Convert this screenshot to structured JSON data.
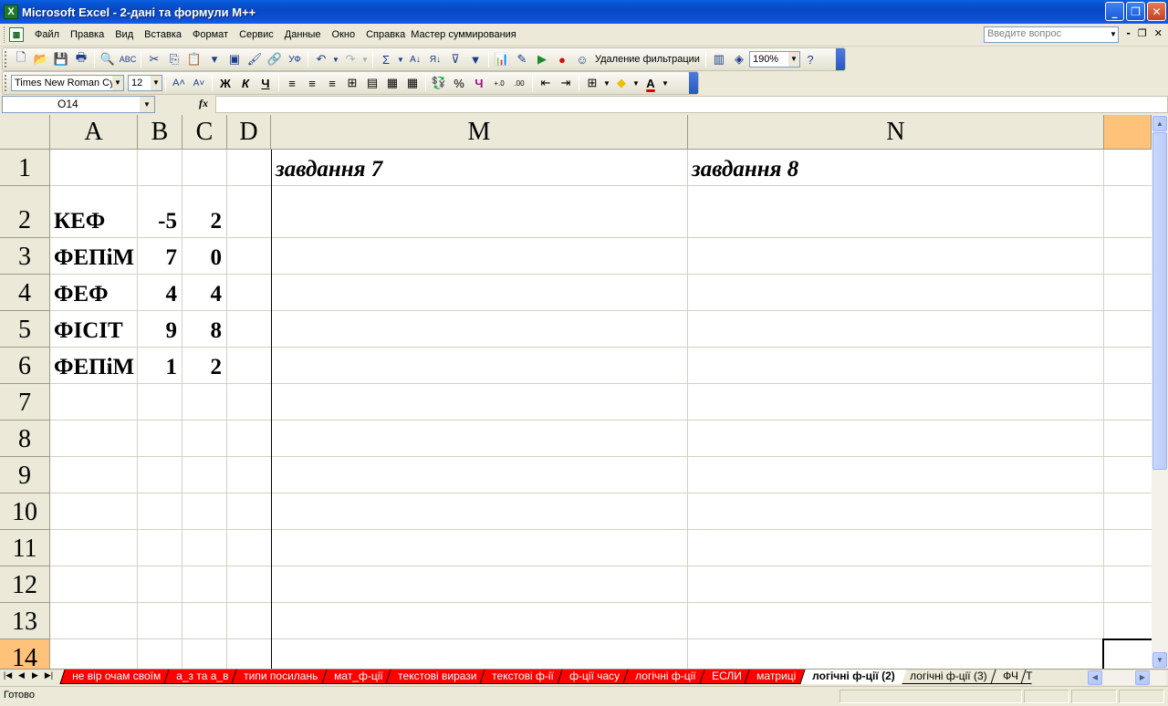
{
  "window": {
    "title": "Microsoft Excel - 2-дані та формули М++",
    "app_icon": "X"
  },
  "menu": {
    "items": [
      "Файл",
      "Правка",
      "Вид",
      "Вставка",
      "Формат",
      "Сервис",
      "Данные",
      "Окно",
      "Справка",
      "Мастер суммирования"
    ],
    "help_placeholder": "Введите вопрос"
  },
  "toolbar1": {
    "remove_filter_label": "Удаление фильтрации",
    "zoom": "190%"
  },
  "toolbar2": {
    "font_name": "Times New Roman Cyr",
    "font_size": "12",
    "bold": "Ж",
    "italic": "К",
    "underline": "Ч"
  },
  "formula_bar": {
    "cell_ref": "O14",
    "fx": "fx",
    "formula": ""
  },
  "sheet": {
    "columns": [
      "A",
      "B",
      "C",
      "D",
      "M",
      "N"
    ],
    "rows": [
      "1",
      "2",
      "3",
      "4",
      "5",
      "6",
      "7",
      "8",
      "9",
      "10",
      "11",
      "12",
      "13",
      "14"
    ],
    "cells": {
      "M1": "завдання 7",
      "N1": "завдання 8",
      "A2": "КЕФ",
      "B2": "-5",
      "C2": "2",
      "A3": "ФЕПіМ",
      "B3": "7",
      "C3": "0",
      "A4": "ФЕФ",
      "B4": "4",
      "C4": "4",
      "A5": "ФІСІТ",
      "B5": "9",
      "C5": "8",
      "A6": "ФЕПіМ",
      "B6": "1",
      "C6": "2"
    }
  },
  "tabs": [
    "не вір очам своїм",
    "а_з та а_в",
    "типи посилань",
    "мат_ф-ції",
    "текстові вирази",
    "текстові ф-ії",
    "ф-ції часу",
    "логічні ф-ції",
    "ЕСЛИ",
    "матриці",
    "логічні ф-ції (2)",
    "логічні ф-ції (3)",
    "ФЧ",
    "Т"
  ],
  "status": {
    "text": "Готово"
  },
  "colors": {
    "selected_header": "#ffc27a",
    "tab_red": "#ff0000"
  }
}
